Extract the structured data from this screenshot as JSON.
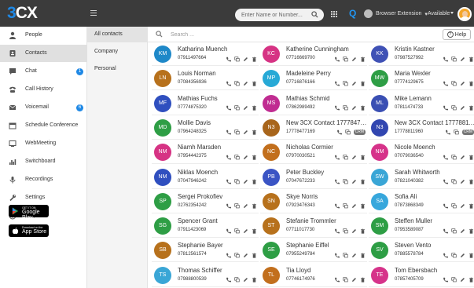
{
  "header": {
    "logo_prefix": "3",
    "logo_suffix": "CX",
    "search_placeholder": "Enter Name or Number...",
    "q_icon": "Q",
    "browser_extension_label": "Browser Extension",
    "status_label": "Available"
  },
  "sidebar": {
    "items": [
      {
        "label": "People",
        "icon": "person-icon"
      },
      {
        "label": "Contacts",
        "icon": "contacts-book-icon",
        "active": true
      },
      {
        "label": "Chat",
        "icon": "chat-bubble-icon",
        "badge": "1"
      },
      {
        "label": "Call History",
        "icon": "phone-history-icon"
      },
      {
        "label": "Voicemail",
        "icon": "voicemail-envelope-icon",
        "badge": "6"
      },
      {
        "label": "Schedule Conference",
        "icon": "calendar-icon"
      },
      {
        "label": "WebMeeting",
        "icon": "webmeeting-icon"
      },
      {
        "label": "Switchboard",
        "icon": "bar-chart-icon"
      },
      {
        "label": "Recordings",
        "icon": "microphone-icon"
      },
      {
        "label": "Settings",
        "icon": "wrench-icon"
      },
      {
        "label": "Help",
        "icon": "info-icon"
      }
    ],
    "google_play": {
      "small": "GET IT ON",
      "big": "Google Play"
    },
    "app_store": {
      "small": "Download on the",
      "big": "App Store"
    }
  },
  "subnav": {
    "items": [
      {
        "label": "All contacts",
        "active": true
      },
      {
        "label": "Company"
      },
      {
        "label": "Personal"
      }
    ]
  },
  "main": {
    "search_placeholder": "Search ...",
    "help_label": "Help",
    "contacts": [
      {
        "initials": "KM",
        "name": "Katharina Muench",
        "number": "07911497664",
        "color": "#1e88c8"
      },
      {
        "initials": "KC",
        "name": "Katherine Cunningham",
        "number": "07716669700",
        "color": "#d63384"
      },
      {
        "initials": "KK",
        "name": "Kristin Kastner",
        "number": "07987527992",
        "color": "#3f51b5"
      },
      {
        "initials": "LN",
        "name": "Louis Norman",
        "number": "07084356936",
        "color": "#b7711c"
      },
      {
        "initials": "MP",
        "name": "Madeleine Perry",
        "number": "07716876166",
        "color": "#27a9d6"
      },
      {
        "initials": "MW",
        "name": "Maria Wexler",
        "number": "07774129675",
        "color": "#2e9e45"
      },
      {
        "initials": "MF",
        "name": "Mathias Fuchs",
        "number": "07774875320",
        "color": "#2f4fbf"
      },
      {
        "initials": "MS",
        "name": "Mathias Schmid",
        "number": "07862989492",
        "color": "#c02c91"
      },
      {
        "initials": "ML",
        "name": "Mike Lemann",
        "number": "07811474733",
        "color": "#3a4fb3"
      },
      {
        "initials": "MD",
        "name": "Mollie Davis",
        "number": "07964248325",
        "color": "#2e9e45"
      },
      {
        "initials": "N3",
        "name": "New 3CX Contact 17778477...",
        "number": "17778477169",
        "color": "#a8651b",
        "crm": true
      },
      {
        "initials": "N3",
        "name": "New 3CX Contact 17778811...",
        "number": "17778811960",
        "color": "#3146b0",
        "crm": true
      },
      {
        "initials": "NM",
        "name": "Niamh Marsden",
        "number": "07954442375",
        "color": "#d63384"
      },
      {
        "initials": "NC",
        "name": "Nicholas Cormier",
        "number": "07970030521",
        "color": "#c26f1d"
      },
      {
        "initials": "NM",
        "name": "Nicole Moench",
        "number": "07079036540",
        "color": "#d6338a"
      },
      {
        "initials": "NM",
        "name": "Niklas Moench",
        "number": "07047946242",
        "color": "#2f4fbf"
      },
      {
        "initials": "PB",
        "name": "Peter Buckley",
        "number": "07047672233",
        "color": "#3a54c4"
      },
      {
        "initials": "SW",
        "name": "Sarah Whitworth",
        "number": "07821040382",
        "color": "#3aa6d6"
      },
      {
        "initials": "SP",
        "name": "Sergei Prokofiev",
        "number": "02762354242",
        "color": "#2e9e45"
      },
      {
        "initials": "SN",
        "name": "Skye Norris",
        "number": "07923476343",
        "color": "#b7711c"
      },
      {
        "initials": "SA",
        "name": "Sofia Ali",
        "number": "07873868349",
        "color": "#37a7dc"
      },
      {
        "initials": "SG",
        "name": "Spencer Grant",
        "number": "07911423069",
        "color": "#2e9e45"
      },
      {
        "initials": "ST",
        "name": "Stefanie Trommler",
        "number": "07711017730",
        "color": "#b7711c"
      },
      {
        "initials": "SM",
        "name": "Steffen Muller",
        "number": "07953589087",
        "color": "#2e9e45"
      },
      {
        "initials": "SB",
        "name": "Stephanie Bayer",
        "number": "07812561574",
        "color": "#b7711c"
      },
      {
        "initials": "SE",
        "name": "Stephanie Eiffel",
        "number": "07955249784",
        "color": "#2e9e45"
      },
      {
        "initials": "SV",
        "name": "Steven Vento",
        "number": "07885578784",
        "color": "#2e9e45"
      },
      {
        "initials": "TS",
        "name": "Thomas Schiffer",
        "number": "07988800539",
        "color": "#3aa6d6"
      },
      {
        "initials": "TL",
        "name": "Tia Lloyd",
        "number": "07746174976",
        "color": "#c26f1d"
      },
      {
        "initials": "TE",
        "name": "Tom Ebersbach",
        "number": "07857405709",
        "color": "#d6338a"
      }
    ]
  }
}
